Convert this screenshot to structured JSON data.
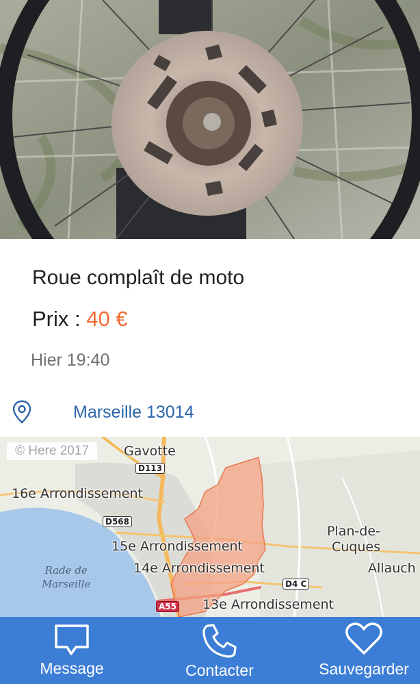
{
  "listing": {
    "title": "Roue complaît de moto",
    "price_label": "Prix : ",
    "price_value": "40 €",
    "posted": "Hier 19:40",
    "location": "Marseille 13014"
  },
  "map": {
    "copyright": "© Here 2017",
    "labels": [
      "Gavotte",
      "16e Arrondissement",
      "15e Arrondissement",
      "14e Arrondissement",
      "13e Arrondissement",
      "Plan-de-",
      "Cuques",
      "Allauch"
    ],
    "sea_label": [
      "Rade de",
      "Marseille"
    ],
    "roads": [
      "D113",
      "D568",
      "D4 C",
      "A55"
    ],
    "highlight_color": "#f4a183"
  },
  "tabbar": {
    "tabs": [
      {
        "label": "Message",
        "icon": "message-icon"
      },
      {
        "label": "Contacter",
        "icon": "phone-icon"
      },
      {
        "label": "Sauvegarder",
        "icon": "heart-icon"
      }
    ],
    "color": "#3c7ed6"
  }
}
